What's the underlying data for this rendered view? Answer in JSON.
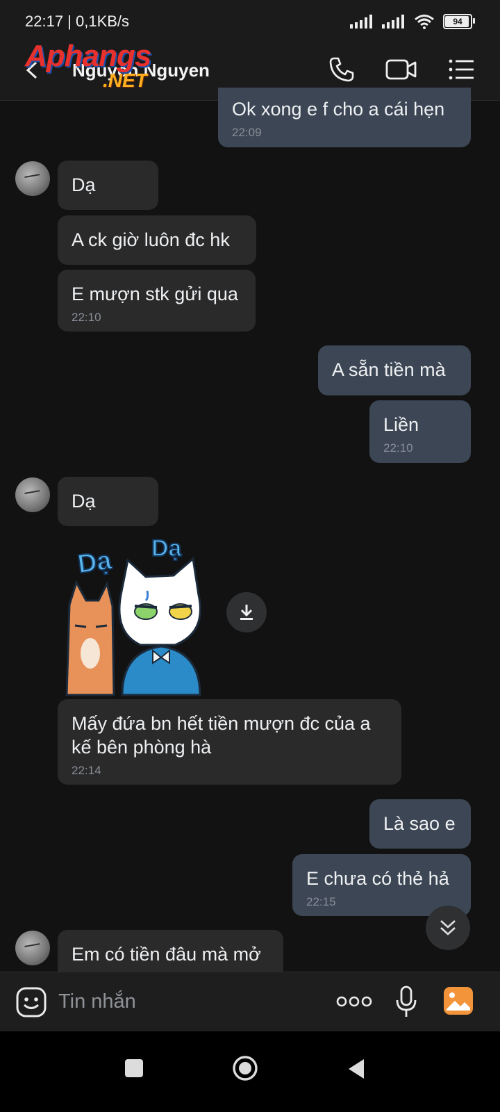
{
  "status_bar": {
    "time": "22:17 | 0,1KB/s",
    "battery": "94"
  },
  "header": {
    "contact_name": "Nguyen Nguyen",
    "watermark_top": "Aphangs",
    "watermark_bottom": ".NET"
  },
  "messages": [
    {
      "dir": "out",
      "text": "Ok xong e f cho a cái hẹn",
      "time": "22:09"
    },
    {
      "dir": "in",
      "text": "Dạ",
      "time": ""
    },
    {
      "dir": "in",
      "text": "A ck giờ luôn đc hk",
      "time": ""
    },
    {
      "dir": "in",
      "text": "E mượn stk gửi qua",
      "time": "22:10"
    },
    {
      "dir": "out",
      "text": "A sẵn tiền mà",
      "time": ""
    },
    {
      "dir": "out",
      "text": "Liền",
      "time": "22:10"
    },
    {
      "dir": "in",
      "text": "Dạ",
      "time": ""
    },
    {
      "dir": "in",
      "text": "Mấy đứa bn hết tiền mượn đc của a kế bên phòng hà",
      "time": "22:14"
    },
    {
      "dir": "out",
      "text": "Là sao e",
      "time": ""
    },
    {
      "dir": "out",
      "text": "E chưa có thẻ hả",
      "time": "22:15"
    },
    {
      "dir": "in",
      "text": "Em có tiền đâu mà mở",
      "time": ""
    }
  ],
  "sticker": {
    "label_left": "Dạ",
    "label_right": "Dạ"
  },
  "input": {
    "placeholder": "Tin nhắn"
  },
  "icons": {
    "back": "back-arrow-icon",
    "call": "phone-icon",
    "video": "video-call-icon",
    "menu": "list-menu-icon",
    "emoji": "emoji-icon",
    "more": "more-dots-icon",
    "mic": "microphone-icon",
    "gallery": "gallery-icon",
    "download": "download-icon",
    "scroll": "scroll-down-icon"
  },
  "colors": {
    "incoming_bubble": "#2a2a2b",
    "outgoing_bubble": "#3c4654",
    "gallery_accent": "#f4943a"
  }
}
